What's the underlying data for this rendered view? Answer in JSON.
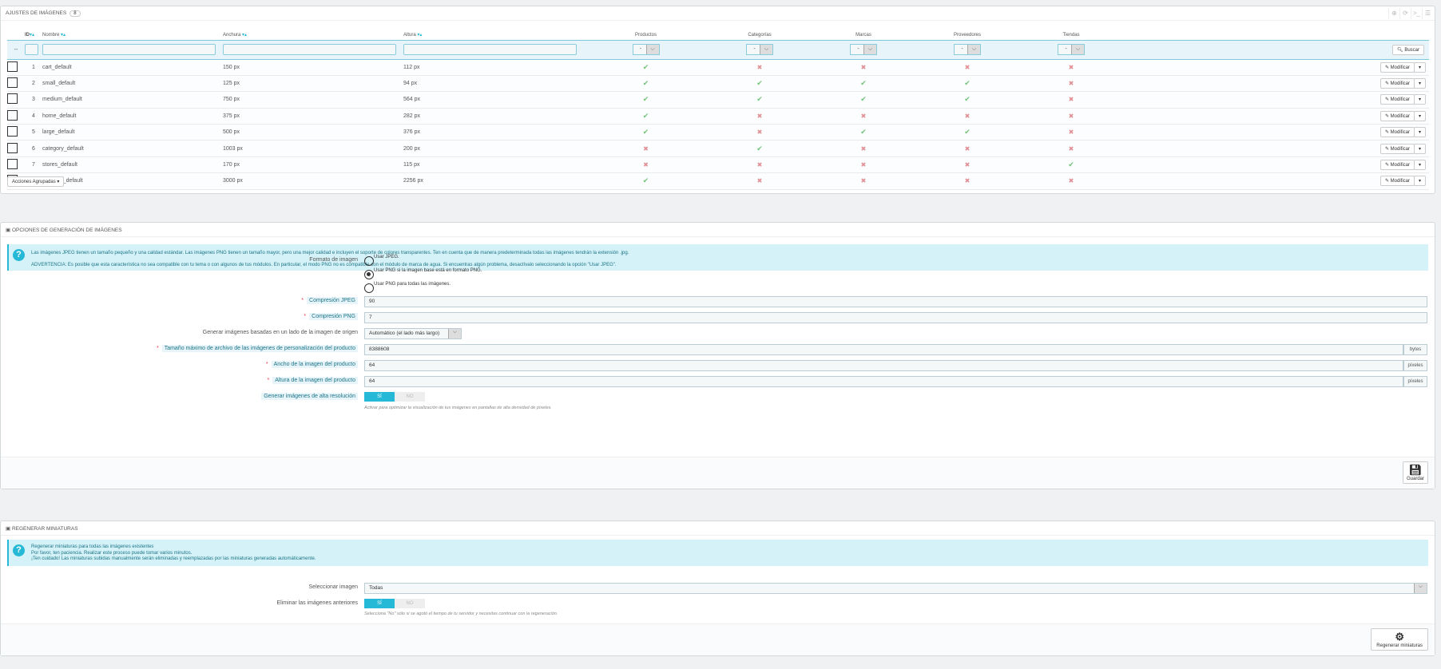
{
  "images_panel": {
    "title": "Ajustes de imágenes",
    "count": "8",
    "columns": {
      "id": "ID",
      "name": "Nombre",
      "width": "Anchura",
      "height": "Altura",
      "products": "Productos",
      "categories": "Categorías",
      "manufacturers": "Marcas",
      "suppliers": "Proveedores",
      "stores": "Tiendas"
    },
    "filter_dash": "--",
    "filter_select": "-",
    "search_label": "Buscar",
    "edit_label": "Modificar",
    "bulk_label": "Acciones Agrupadas",
    "rows": [
      {
        "id": "1",
        "name": "cart_default",
        "width": "150 px",
        "height": "112 px",
        "flags": [
          true,
          false,
          false,
          false,
          false
        ]
      },
      {
        "id": "2",
        "name": "small_default",
        "width": "125 px",
        "height": "94 px",
        "flags": [
          true,
          true,
          true,
          true,
          false
        ]
      },
      {
        "id": "3",
        "name": "medium_default",
        "width": "750 px",
        "height": "564 px",
        "flags": [
          true,
          true,
          true,
          true,
          false
        ]
      },
      {
        "id": "4",
        "name": "home_default",
        "width": "375 px",
        "height": "282 px",
        "flags": [
          true,
          false,
          false,
          false,
          false
        ]
      },
      {
        "id": "5",
        "name": "large_default",
        "width": "500 px",
        "height": "376 px",
        "flags": [
          true,
          false,
          true,
          true,
          false
        ]
      },
      {
        "id": "6",
        "name": "category_default",
        "width": "1003 px",
        "height": "200 px",
        "flags": [
          false,
          true,
          false,
          false,
          false
        ]
      },
      {
        "id": "7",
        "name": "stores_default",
        "width": "170 px",
        "height": "115 px",
        "flags": [
          false,
          false,
          false,
          false,
          true
        ]
      },
      {
        "id": "8",
        "name": "thickbox_default",
        "width": "3000 px",
        "height": "2256 px",
        "flags": [
          true,
          false,
          false,
          false,
          false
        ]
      }
    ]
  },
  "options_panel": {
    "title": "Opciones de generación de imágenes",
    "info1": "Las imágenes JPEG tienen un tamaño pequeño y una calidad estándar. Las imágenes PNG tienen un tamaño mayor, pero una mejor calidad e incluyen el soporte de colores transparentes. Ten en cuenta que de manera predeterminada todas las imágenes tendrán la extensión .jpg.",
    "info2": "ADVERTENCIA: Es posible que esta característica no sea compatible con tu tema o con algunos de tus módulos. En particular, el modo PNG no es compatible con el módulo de marca de agua. Si encuentras algún problema, desactívalo seleccionando la opción \"Usar JPEG\".",
    "format_label": "Formato de imagen",
    "format_options": [
      "Usar JPEG.",
      "Usar PNG si la imagen base está en formato PNG.",
      "Usar PNG para todas las imágenes."
    ],
    "format_selected": 1,
    "jpeg_label": "Compresión JPEG",
    "jpeg_value": "90",
    "png_label": "Compresión PNG",
    "png_value": "7",
    "side_label": "Generar imágenes basadas en un lado de la imagen de origen",
    "side_value": "Automático (el lado más largo)",
    "maxsize_label": "Tamaño máximo de archivo de las imágenes de personalización del producto",
    "maxsize_value": "8388608",
    "maxsize_unit": "bytes",
    "pw_label": "Ancho de la imagen del producto",
    "pw_value": "64",
    "pw_unit": "píxeles",
    "ph_label": "Altura de la imagen del producto",
    "ph_value": "64",
    "ph_unit": "píxeles",
    "hires_label": "Generar imágenes de alta resolución",
    "yes": "SÍ",
    "no": "NO",
    "hires_help": "Activar para optimizar la visualización de tus imágenes en pantallas de alta densidad de píxeles.",
    "save_label": "Guardar"
  },
  "regen_panel": {
    "title": "Regenerar miniaturas",
    "info": [
      "Regenerar miniaturas para todas las imágenes existentes",
      "Por favor, ten paciencia. Realizar este proceso puede tomar varios minutos.",
      "¡Ten cuidado! Las miniaturas subidas manualmente serán eliminadas y reemplazadas por las miniaturas generadas automáticamente."
    ],
    "select_label": "Seleccionar imagen",
    "select_value": "Todas",
    "erase_label": "Eliminar las imágenes anteriores",
    "yes": "SÍ",
    "no": "NO",
    "erase_help": "Selecciona \"No\" sólo si se agotó el tiempo de tu servidor y necesitas continuar con la regeneración.",
    "regen_label": "Regenerar miniaturas"
  }
}
